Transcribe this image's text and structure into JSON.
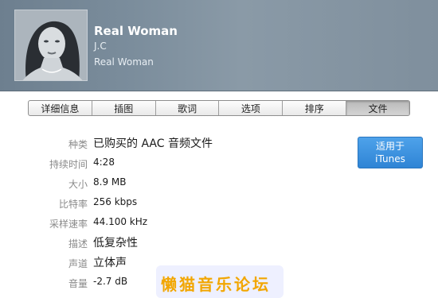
{
  "header": {
    "title": "Real Woman",
    "artist": "J.C",
    "album": "Real Woman"
  },
  "tabs": [
    {
      "label": "详细信息",
      "active": false
    },
    {
      "label": "插图",
      "active": false
    },
    {
      "label": "歌词",
      "active": false
    },
    {
      "label": "选项",
      "active": false
    },
    {
      "label": "排序",
      "active": false
    },
    {
      "label": "文件",
      "active": true
    }
  ],
  "file_info": [
    {
      "label": "种类",
      "value": "已购买的 AAC 音频文件"
    },
    {
      "label": "持续时间",
      "value": "4:28"
    },
    {
      "label": "大小",
      "value": "8.9 MB"
    },
    {
      "label": "比特率",
      "value": "256 kbps"
    },
    {
      "label": "采样速率",
      "value": "44.100 kHz"
    },
    {
      "label": "描述",
      "value": "低复杂性"
    },
    {
      "label": "声道",
      "value": "立体声"
    },
    {
      "label": "音量",
      "value": "-2.7 dB"
    }
  ],
  "button": {
    "line1": "适用于",
    "line2": "iTunes"
  },
  "watermark": "懒猫音乐论坛",
  "colors": {
    "header_bg": "#7b8d9c",
    "button_bg": "#3b8ee0",
    "watermark_text": "#f2a600"
  }
}
